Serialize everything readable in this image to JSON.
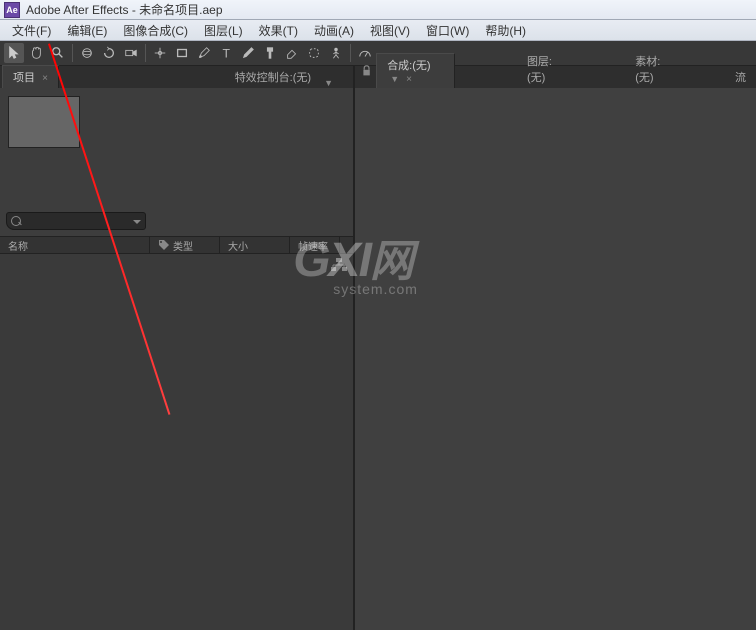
{
  "window": {
    "title": "Adobe After Effects - 未命名项目.aep",
    "icon_label": "Ae"
  },
  "menu": {
    "items": [
      "文件(F)",
      "编辑(E)",
      "图像合成(C)",
      "图层(L)",
      "效果(T)",
      "动画(A)",
      "视图(V)",
      "窗口(W)",
      "帮助(H)"
    ]
  },
  "panels": {
    "project_tab": "项目",
    "effects_tab": "特效控制台:(无)",
    "composition_tab": "合成:(无)",
    "layer_tab": "图层:(无)",
    "footage_tab": "素材:(无)",
    "flow_tab": "流"
  },
  "columns": {
    "name": "名称",
    "type": "类型",
    "size": "大小",
    "fps": "帧速率"
  },
  "search": {
    "placeholder": ""
  },
  "watermark": {
    "main_g": "G",
    "main_x": "X",
    "main_i": "I",
    "main_net": "网",
    "sub": "system.com"
  }
}
